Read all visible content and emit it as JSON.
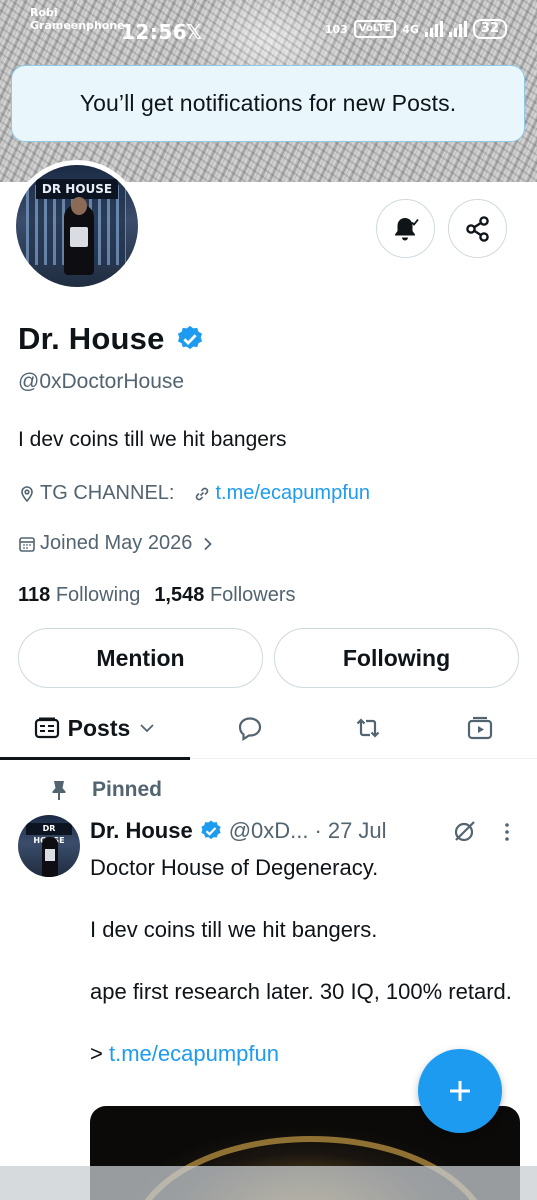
{
  "status_bar": {
    "carrier_line1": "Robi",
    "carrier_line2": "Grameenphone",
    "time": "12:56",
    "app_icon": "x-logo-icon",
    "speed": "103",
    "volte": "VoLTE",
    "network": "4G",
    "battery": "32"
  },
  "toast": {
    "text": "You’ll get notifications for new Posts."
  },
  "profile": {
    "avatar_sign": "DR HOUSE",
    "display_name": "Dr. House",
    "handle": "@0xDoctorHouse",
    "bio": "I dev coins till we hit bangers",
    "location": "TG CHANNEL:",
    "website": "t.me/ecapumpfun",
    "joined": "Joined May 2026",
    "following_count": "118",
    "following_label": "Following",
    "followers_count": "1,548",
    "followers_label": "Followers",
    "verified_color": "#1d9bf0"
  },
  "actions": {
    "mention_label": "Mention",
    "following_label": "Following"
  },
  "tabs": {
    "posts_label": "Posts",
    "icons": [
      "posts-icon",
      "replies-icon",
      "reposts-icon",
      "media-icon"
    ]
  },
  "pinned_post": {
    "pinned_label": "Pinned",
    "avatar_sign": "DR HOUSE",
    "author_name": "Dr. House",
    "author_handle": "@0xD...",
    "separator": "·",
    "date": "27 Jul",
    "line1": "Doctor House of Degeneracy.",
    "line2": "I dev coins till we hit bangers.",
    "line3": "ape first research later. 30 IQ, 100% retard.",
    "line4_prefix": ">",
    "line4_link": "t.me/ecapumpfun"
  },
  "colors": {
    "accent": "#1d9bf0",
    "text_primary": "#0f1419",
    "text_secondary": "#536471",
    "border": "#cfd9de"
  }
}
